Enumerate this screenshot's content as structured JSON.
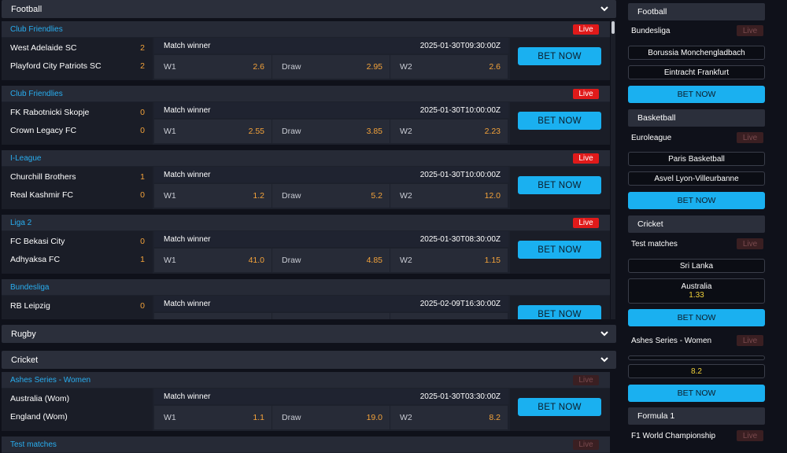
{
  "sections": {
    "football": "Football",
    "rugby": "Rugby",
    "cricket": "Cricket"
  },
  "common": {
    "market": "Match winner",
    "w1": "W1",
    "draw": "Draw",
    "w2": "W2",
    "bet": "BET NOW",
    "live": "Live"
  },
  "matches": [
    {
      "league": "Club Friendlies",
      "home": "West Adelaide SC",
      "home_score": "2",
      "away": "Playford City Patriots SC",
      "away_score": "2",
      "time": "2025-01-30T09:30:00Z",
      "w1": "2.6",
      "draw": "2.95",
      "w2": "2.6"
    },
    {
      "league": "Club Friendlies",
      "home": "FK Rabotnicki Skopje",
      "home_score": "0",
      "away": "Crown Legacy FC",
      "away_score": "0",
      "time": "2025-01-30T10:00:00Z",
      "w1": "2.55",
      "draw": "3.85",
      "w2": "2.23"
    },
    {
      "league": "I-League",
      "home": "Churchill Brothers",
      "home_score": "1",
      "away": "Real Kashmir FC",
      "away_score": "0",
      "time": "2025-01-30T10:00:00Z",
      "w1": "1.2",
      "draw": "5.2",
      "w2": "12.0"
    },
    {
      "league": "Liga 2",
      "home": "FC Bekasi City",
      "home_score": "0",
      "away": "Adhyaksa FC",
      "away_score": "1",
      "time": "2025-01-30T08:30:00Z",
      "w1": "41.0",
      "draw": "4.85",
      "w2": "1.15"
    },
    {
      "league": "Bundesliga",
      "home": "RB Leipzig",
      "home_score": "0",
      "away": "",
      "away_score": "",
      "time": "2025-02-09T16:30:00Z",
      "w1": "",
      "draw": "",
      "w2": ""
    }
  ],
  "cricket_matches": [
    {
      "league": "Ashes Series - Women",
      "home": "Australia (Wom)",
      "away": "England (Wom)",
      "time": "2025-01-30T03:30:00Z",
      "w1": "1.1",
      "draw": "19.0",
      "w2": "8.2"
    },
    {
      "league": "Test matches"
    }
  ],
  "sidebar": {
    "football": {
      "header": "Football",
      "league": "Bundesliga",
      "team1": "Borussia Monchengladbach",
      "team2": "Eintracht Frankfurt"
    },
    "basketball": {
      "header": "Basketball",
      "league": "Euroleague",
      "team1": "Paris Basketball",
      "team2": "Asvel Lyon-Villeurbanne"
    },
    "cricket": {
      "header": "Cricket",
      "league": "Test matches",
      "team1": "Sri Lanka",
      "team2": "Australia",
      "team2_odds": "1.33",
      "league2": "Ashes Series - Women",
      "odds2": "8.2"
    },
    "formula1": {
      "header": "Formula 1",
      "league": "F1 World Championship"
    }
  },
  "colors": {
    "accent": "#1ab0f0",
    "odds": "#f3a23a",
    "live": "#e01a1a",
    "league": "#29aef0"
  },
  "icons": {
    "chevron": "chevron-down-icon"
  }
}
